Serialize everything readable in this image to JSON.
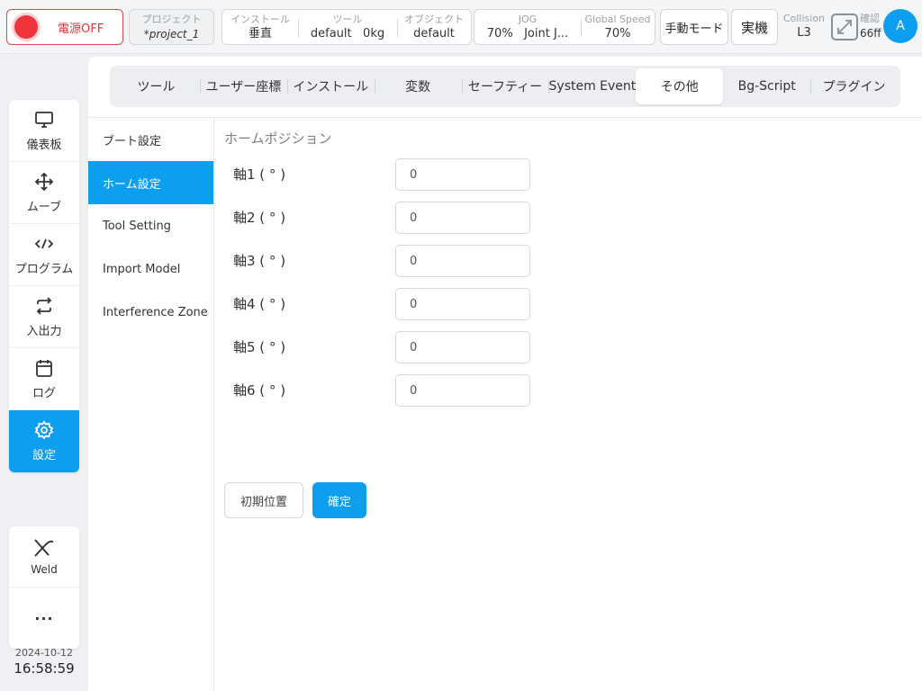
{
  "topbar": {
    "power_label": "電源OFF",
    "project": {
      "label": "プロジェクト",
      "value": "*project_1"
    },
    "install": {
      "label": "インストール",
      "value": "垂直"
    },
    "tool": {
      "label": "ツール",
      "value": "default",
      "weight": "0kg"
    },
    "object": {
      "label": "オブジェクト",
      "value": "default"
    },
    "jog": {
      "label": "JOG",
      "speed": "70%",
      "mode": "Joint J..."
    },
    "global_speed": {
      "label": "Global Speed",
      "value": "70%"
    },
    "manual_mode": "手動モード",
    "real_machine": "実機",
    "collision": {
      "label": "Collision",
      "value": "L3"
    },
    "confirm": {
      "label": "確認",
      "value": "66ff"
    },
    "avatar_letter": "A"
  },
  "nav": {
    "items": [
      {
        "label": "儀表板",
        "icon": "monitor-icon"
      },
      {
        "label": "ムーブ",
        "icon": "move-arrows-icon"
      },
      {
        "label": "プログラム",
        "icon": "code-icon"
      },
      {
        "label": "入出力",
        "icon": "swap-arrows-icon"
      },
      {
        "label": "ログ",
        "icon": "calendar-icon"
      },
      {
        "label": "設定",
        "icon": "gear-icon"
      }
    ],
    "extra": [
      {
        "label": "Weld",
        "icon": "weld-torch-icon"
      },
      {
        "label": "···",
        "icon": "more-icon"
      }
    ]
  },
  "clock": {
    "date": "2024-10-12",
    "time": "16:58:59"
  },
  "tabs": [
    "ツール",
    "ユーザー座標",
    "インストール",
    "変数",
    "セーフティー",
    "System Event",
    "その他",
    "Bg-Script",
    "プラグイン"
  ],
  "side": [
    "ブート設定",
    "ホーム設定",
    "Tool Setting",
    "Import Model",
    "Interference Zone"
  ],
  "home": {
    "title": "ホームポジション",
    "axes": [
      {
        "label": "軸1 ( ° )",
        "value": "0"
      },
      {
        "label": "軸2 ( ° )",
        "value": "0"
      },
      {
        "label": "軸3 ( ° )",
        "value": "0"
      },
      {
        "label": "軸4 ( ° )",
        "value": "0"
      },
      {
        "label": "軸5 ( ° )",
        "value": "0"
      },
      {
        "label": "軸6 ( ° )",
        "value": "0"
      }
    ],
    "init_button": "初期位置",
    "ok_button": "確定"
  },
  "colors": {
    "accent": "#0d9ef0",
    "power_red": "#f0343b"
  }
}
